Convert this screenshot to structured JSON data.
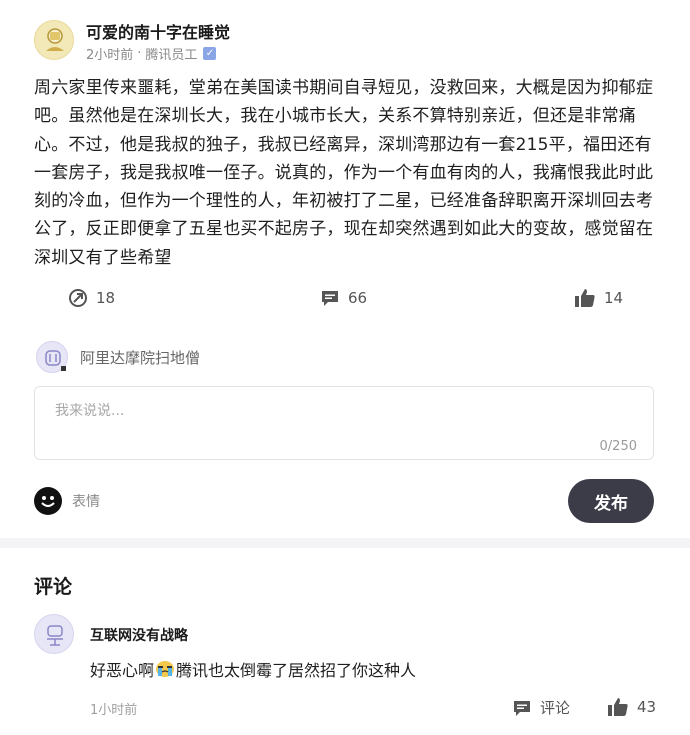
{
  "post": {
    "author": "可爱的南十字在睡觉",
    "meta_time": "2小时前",
    "meta_separator": "·",
    "meta_role": "腾讯员工",
    "verified_badge": "✓",
    "content": "周六家里传来噩耗，堂弟在美国读书期间自寻短见，没救回来，大概是因为抑郁症吧。虽然他是在深圳长大，我在小城市长大，关系不算特别亲近，但还是非常痛心。不过，他是我叔的独子，我叔已经离异，深圳湾那边有一套215平，福田还有一套房子，我是我叔唯一侄子。说真的，作为一个有血有肉的人，我痛恨我此时此刻的冷血，但作为一个理性的人，年初被打了二星，已经准备辞职离开深圳回去考公了，反正即便拿了五星也买不起房子，现在却突然遇到如此大的变故，感觉留在深圳又有了些希望",
    "actions": {
      "share_count": "18",
      "comment_count": "66",
      "like_count": "14"
    }
  },
  "composer": {
    "user_name": "阿里达摩院扫地僧",
    "placeholder": "我来说说...",
    "counter": "0/250",
    "emoji_label": "表情",
    "publish_label": "发布"
  },
  "comments": {
    "title": "评论",
    "items": [
      {
        "name": "互联网没有战略",
        "text_before": "好恶心啊",
        "text_after": "腾讯也太倒霉了居然招了你这种人",
        "time": "1小时前",
        "reply_label": "评论",
        "like_count": "43"
      }
    ]
  },
  "colors": {
    "publish_button": "#3b3c48",
    "divider": "#f4f4f6",
    "verified": "#8aa6e6"
  }
}
